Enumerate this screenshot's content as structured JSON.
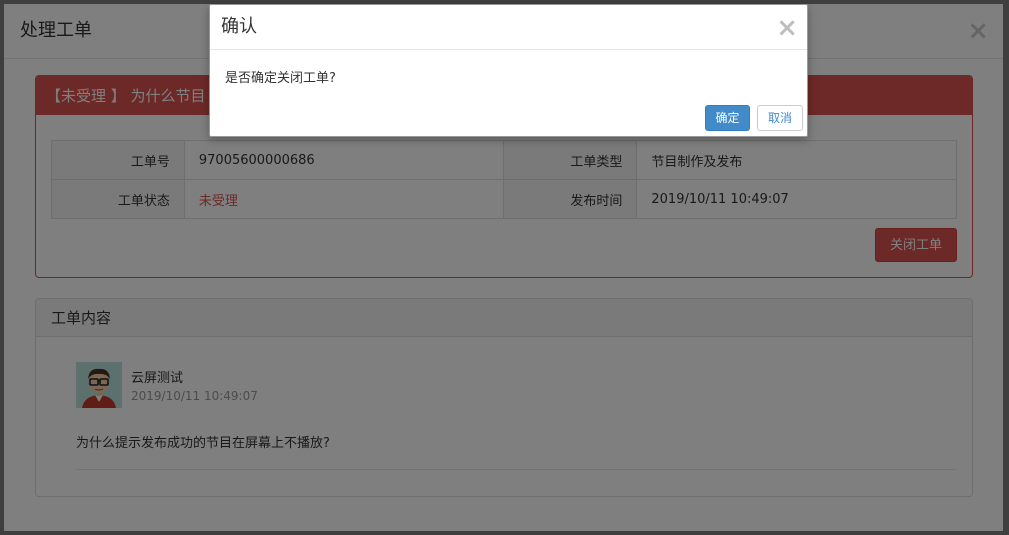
{
  "main_modal": {
    "title": "处理工单",
    "close_glyph": "×"
  },
  "order_panel": {
    "heading": "【未受理 】 为什么节目",
    "labels": {
      "order_no": "工单号",
      "order_type": "工单类型",
      "order_status": "工单状态",
      "publish_time": "发布时间"
    },
    "values": {
      "order_no": "97005600000686",
      "order_type": "节目制作及发布",
      "order_status": "未受理",
      "publish_time": "2019/10/11 10:49:07"
    },
    "close_order_button": "关闭工单"
  },
  "content_panel": {
    "heading": "工单内容",
    "username": "云屏测试",
    "post_time": "2019/10/11 10:49:07",
    "content": "为什么提示发布成功的节目在屏幕上不播放?"
  },
  "confirm_dialog": {
    "title": "确认",
    "close_glyph": "×",
    "message": "是否确定关闭工单?",
    "ok_label": "确定",
    "cancel_label": "取消"
  },
  "colors": {
    "danger": "#d9534f",
    "primary": "#428bca"
  },
  "icons": {
    "avatar": "user-avatar-cartoon"
  }
}
